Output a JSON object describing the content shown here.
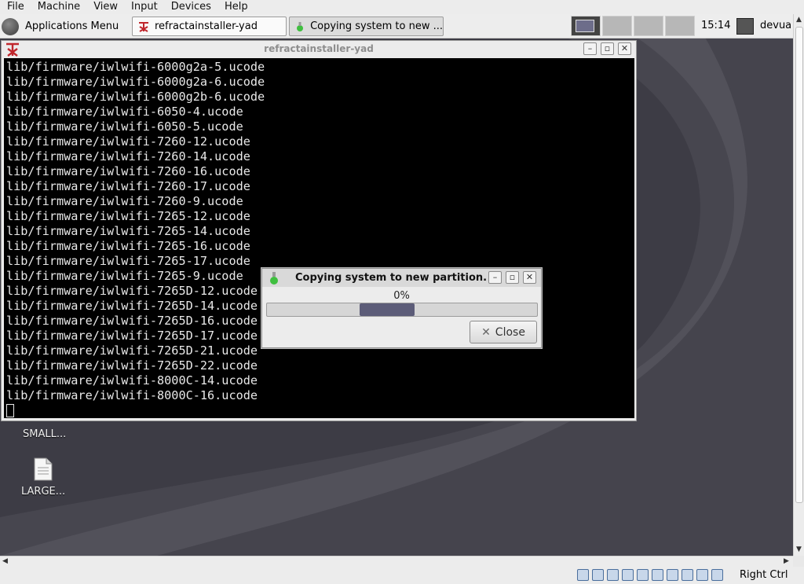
{
  "host_menubar": {
    "items": [
      "File",
      "Machine",
      "View",
      "Input",
      "Devices",
      "Help"
    ]
  },
  "panel": {
    "applications_menu": "Applications Menu",
    "tasks": [
      {
        "label": "refractainstaller-yad"
      },
      {
        "label": "Copying system to new ..."
      }
    ],
    "clock": "15:14",
    "user": "devua"
  },
  "terminal": {
    "title": "refractainstaller-yad",
    "lines": [
      "lib/firmware/iwlwifi-6000g2a-5.ucode",
      "lib/firmware/iwlwifi-6000g2a-6.ucode",
      "lib/firmware/iwlwifi-6000g2b-6.ucode",
      "lib/firmware/iwlwifi-6050-4.ucode",
      "lib/firmware/iwlwifi-6050-5.ucode",
      "lib/firmware/iwlwifi-7260-12.ucode",
      "lib/firmware/iwlwifi-7260-14.ucode",
      "lib/firmware/iwlwifi-7260-16.ucode",
      "lib/firmware/iwlwifi-7260-17.ucode",
      "lib/firmware/iwlwifi-7260-9.ucode",
      "lib/firmware/iwlwifi-7265-12.ucode",
      "lib/firmware/iwlwifi-7265-14.ucode",
      "lib/firmware/iwlwifi-7265-16.ucode",
      "lib/firmware/iwlwifi-7265-17.ucode",
      "lib/firmware/iwlwifi-7265-9.ucode",
      "lib/firmware/iwlwifi-7265D-12.ucode",
      "lib/firmware/iwlwifi-7265D-14.ucode",
      "lib/firmware/iwlwifi-7265D-16.ucode",
      "lib/firmware/iwlwifi-7265D-17.ucode",
      "lib/firmware/iwlwifi-7265D-21.ucode",
      "lib/firmware/iwlwifi-7265D-22.ucode",
      "lib/firmware/iwlwifi-8000C-14.ucode",
      "lib/firmware/iwlwifi-8000C-16.ucode"
    ]
  },
  "desktop": {
    "icons": [
      {
        "label": "SMALL..."
      },
      {
        "label": "LARGE..."
      }
    ]
  },
  "dialog": {
    "title": "Copying system to new partition.",
    "percent_text": "0%",
    "progress": 0,
    "close_label": "Close"
  },
  "status_bar": {
    "host_key": "Right Ctrl"
  },
  "colors": {
    "terminal_bg": "#000000",
    "terminal_fg": "#e8e8e8",
    "desktop_bg": "#3d3c45",
    "progress_pulse": "#5c5c78"
  }
}
